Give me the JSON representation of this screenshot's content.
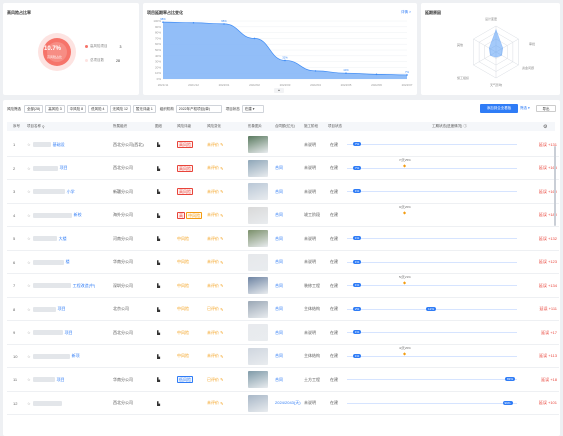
{
  "panel_left": {
    "title": "高风险占比率",
    "percent": "10.7%",
    "sub": "高风险占比",
    "legend": [
      {
        "label": "高风险项目",
        "value": "3"
      },
      {
        "label": "总项目数",
        "value": "28"
      }
    ]
  },
  "panel_mid": {
    "title": "项目延期率占比变化",
    "more": "详情 >"
  },
  "panel_right": {
    "title": "延期原因",
    "axes": [
      "设计变更",
      "审批",
      "资金问题",
      "天气影响",
      "施工组织",
      "其他"
    ]
  },
  "chart_data": {
    "type": "area",
    "title": "项目延期率占比变化",
    "categories": [
      "2021/11",
      "2021/12",
      "2022/01",
      "2022/02",
      "2022/03",
      "2022/04",
      "2022/05",
      "2022/06",
      "2022/07"
    ],
    "values": [
      98,
      97,
      95,
      70,
      32,
      14,
      10,
      8,
      7
    ],
    "point_labels": [
      "98%",
      "",
      "95%",
      "",
      "32%",
      "",
      "10%",
      "",
      "7%"
    ],
    "y_ticks": [
      "100%",
      "90%",
      "80%",
      "70%",
      "60%",
      "50%",
      "40%",
      "30%",
      "20%",
      "10%",
      "0%"
    ],
    "ylim": [
      0,
      100
    ],
    "color": "#7fb3f7"
  },
  "filters": {
    "label": "风险筛选",
    "chips": [
      "全部(28)",
      "高风险 3",
      "中风险 8",
      "低风险 4",
      "无风险 12",
      "暂无评级 1"
    ],
    "org_label": "组织机构",
    "org_value": "2022年产权项目(单)",
    "status_label": "项目状态",
    "status_value": "在建",
    "primary_btn": "添加到企业看板",
    "right_btn": "筛选",
    "export_btn": "导出"
  },
  "columns": [
    "序号",
    "项目名称",
    "所属组织",
    "图纸",
    "风险评级",
    "风险变化",
    "形象图片",
    "合同额(亿元)",
    "施工阶段",
    "项目状态",
    "工期状态(进度情况)",
    ""
  ],
  "rows": [
    {
      "no": "1",
      "name": "基础设",
      "org": "西北分公司(西北)",
      "risk": "高风险",
      "riskType": "red",
      "change": "未评价",
      "contract": "",
      "stage": "未说明",
      "status": "在建",
      "bars": [
        {
          "label": "7%",
          "pos": 7
        }
      ],
      "marker": null,
      "remark": "延误 +131"
    },
    {
      "no": "2",
      "name": "项目",
      "org": "西北分公司",
      "risk": "高风险",
      "riskType": "red",
      "change": "未评价",
      "contract": "合同",
      "stage": "未说明",
      "status": "在建",
      "bars": [
        {
          "label": "7%",
          "pos": 7
        }
      ],
      "marker": "7(天)/5%",
      "remark": "延误 +165"
    },
    {
      "no": "3",
      "name": "小学",
      "org": "新疆分公司",
      "risk": "高风险",
      "riskType": "red",
      "change": "未评价",
      "contract": "合同",
      "stage": "未说明",
      "status": "在建",
      "bars": [
        {
          "label": "1%",
          "pos": 7
        }
      ],
      "marker": null,
      "remark": "延误 +160"
    },
    {
      "no": "4",
      "name": "新校",
      "org": "海外分公司",
      "risk": "中风险",
      "riskType": "red2",
      "change": "未评价",
      "contract": "合同",
      "stage": "竣工阶段",
      "status": "在建",
      "bars": [],
      "marker": "0(天)/0%",
      "remark": "延误 +180"
    },
    {
      "no": "5",
      "name": "大楼",
      "org": "河南分公司",
      "risk": "中风险",
      "riskType": "orange",
      "change": "未评价",
      "contract": "合同",
      "stage": "未说明",
      "status": "在建",
      "bars": [
        {
          "label": "1%",
          "pos": 7
        }
      ],
      "marker": null,
      "remark": "延误 +132"
    },
    {
      "no": "6",
      "name": "楼",
      "org": "华南分公司",
      "risk": "中风险",
      "riskType": "orange",
      "change": "未评价",
      "contract": "合同",
      "stage": "未说明",
      "status": "在建",
      "bars": [
        {
          "label": "1%",
          "pos": 7
        }
      ],
      "marker": null,
      "remark": "延误 +123"
    },
    {
      "no": "7",
      "name": "工程改造(中)",
      "org": "深圳分公司",
      "risk": "中风险",
      "riskType": "orange",
      "change": "未评价",
      "contract": "合同",
      "stage": "装修工程",
      "status": "在建",
      "bars": [
        {
          "label": "1%",
          "pos": 7
        }
      ],
      "marker": "5(天)/1%",
      "remark": "延误 +134"
    },
    {
      "no": "8",
      "name": "项目",
      "org": "北京公司",
      "risk": "中风险",
      "riskType": "orange",
      "change": "已评价",
      "contract": "合同",
      "stage": "主体结构",
      "status": "在建",
      "bars": [
        {
          "label": "2%",
          "pos": 7
        },
        {
          "label": "12%",
          "pos": 50
        }
      ],
      "marker": null,
      "remark": "延误 +111"
    },
    {
      "no": "9",
      "name": "项目",
      "org": "西北分公司",
      "risk": "中风险",
      "riskType": "orange",
      "change": "未评价",
      "contract": "合同",
      "stage": "未说明",
      "status": "在建",
      "bars": [
        {
          "label": "1%",
          "pos": 7
        }
      ],
      "marker": null,
      "remark": "延误 +17"
    },
    {
      "no": "10",
      "name": "新项",
      "org": "",
      "risk": "中风险",
      "riskType": "orange",
      "change": "未评价",
      "contract": "合同",
      "stage": "主体结构",
      "status": "在建",
      "bars": [
        {
          "label": "1%",
          "pos": 7
        }
      ],
      "marker": "4(天)/0%",
      "remark": "延误 +113"
    },
    {
      "no": "11",
      "name": "项目",
      "org": "华南分公司",
      "risk": "低风险",
      "riskType": "blue",
      "change": "已评价",
      "contract": "合同",
      "stage": "土方工程",
      "status": "在建",
      "bars": [
        {
          "label": "83%",
          "pos": 97
        }
      ],
      "marker": null,
      "remark": "延误 +18"
    },
    {
      "no": "12",
      "name": "",
      "org": "西北分公司",
      "risk": "",
      "riskType": "none",
      "change": "未评价",
      "contract": "2024/2043(天)",
      "stage": "未说明",
      "status": "在建",
      "bars": [
        {
          "label": "99%",
          "pos": 95
        }
      ],
      "marker": null,
      "remark": "延误 +101"
    }
  ]
}
